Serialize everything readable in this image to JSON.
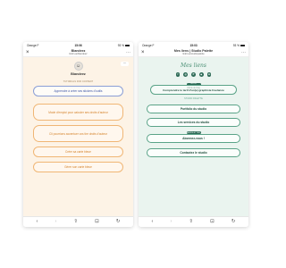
{
  "left_phone": {
    "status": {
      "carrier": "Orange F",
      "time": "15:06",
      "battery": "93 %"
    },
    "address": {
      "title": "Blandeez",
      "url": "linktr.ee/blandeez",
      "more": "⋯"
    },
    "profile": {
      "username": "Blandeez",
      "dots": "⋯"
    },
    "section_note": "TUTORIALS FOR CONTENT",
    "links": [
      "Apprendre à créer ses stickers d'outils",
      "Mode d'emploi pour calculer ses droits d'auteur",
      "Cli pourrions accentuer vos tire droits d'auteur",
      "Créer sa carte bleue",
      "Gérer son carte bleue"
    ]
  },
  "right_phone": {
    "status": {
      "carrier": "Orange F",
      "time": "15:03",
      "battery": "93 %"
    },
    "address": {
      "title": "Mes liens | Studio Palette",
      "url": "linktr.ee/studiopalette",
      "more": "⋯"
    },
    "script_title": "Mes liens",
    "social": [
      "f",
      "◎",
      "P",
      "◆",
      "in"
    ],
    "badge_top": "BLOG",
    "card": {
      "small": "Article de blog",
      "main": "Comprendre le tarif d'un(e) graphiste freelance"
    },
    "section_label": "STUDIO PALETTE",
    "buttons": [
      "Portfolio du studio",
      "Les services du studio",
      "Abonnez-vous !",
      "Contactez le studio"
    ],
    "badge_mid": "NEWSLETTER"
  },
  "browser_nav": [
    "‹",
    "›",
    "⇧",
    "⊡",
    "↻"
  ],
  "colors": {
    "left_bg": "#fdf3e6",
    "right_bg": "#eaf4ef",
    "blue_accent": "#3f57a5",
    "orange_accent": "#d4822a",
    "green_accent": "#2e6b57"
  }
}
